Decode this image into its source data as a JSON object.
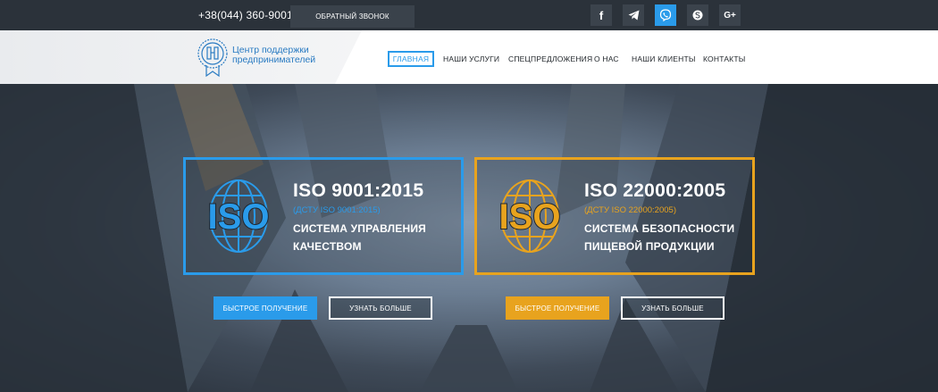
{
  "topbar": {
    "phone": "+38(044) 360-9001",
    "callback_label": "ОБРАТНЫЙ ЗВОНОК",
    "social": [
      "facebook-icon",
      "telegram-icon",
      "viber-icon",
      "skype-icon",
      "google-plus-icon"
    ],
    "social_labels": {
      "facebook": "f",
      "google_plus": "G+"
    }
  },
  "logo": {
    "line1": "Центр поддержки",
    "line2": "предпринимателей"
  },
  "nav": {
    "items": [
      "ГЛАВНАЯ",
      "НАШИ УСЛУГИ",
      "СПЕЦПРЕДЛОЖЕНИЯ",
      "О НАС",
      "НАШИ КЛИЕНТЫ",
      "КОНТАКТЫ"
    ]
  },
  "hero": {
    "cards": [
      {
        "logo_text": "ISO",
        "title": "ISO 9001:2015",
        "subtitle": "(ДСТУ ISO 9001:2015)",
        "desc_line1": "СИСТЕМА УПРАВЛЕНИЯ",
        "desc_line2": "КАЧЕСТВОМ",
        "primary_button": "БЫСТРОЕ ПОЛУЧЕНИЕ",
        "secondary_button": "УЗНАТЬ БОЛЬШЕ",
        "accent": "#2a9bea"
      },
      {
        "logo_text": "ISO",
        "title": "ISO 22000:2005",
        "subtitle": "(ДСТУ ISO 22000:2005)",
        "desc_line1": "СИСТЕМА БЕЗОПАСНОСТИ",
        "desc_line2": "ПИЩЕВОЙ ПРОДУКЦИИ",
        "primary_button": "БЫСТРОЕ ПОЛУЧЕНИЕ",
        "secondary_button": "УЗНАТЬ БОЛЬШЕ",
        "accent": "#e8a31e"
      }
    ]
  }
}
